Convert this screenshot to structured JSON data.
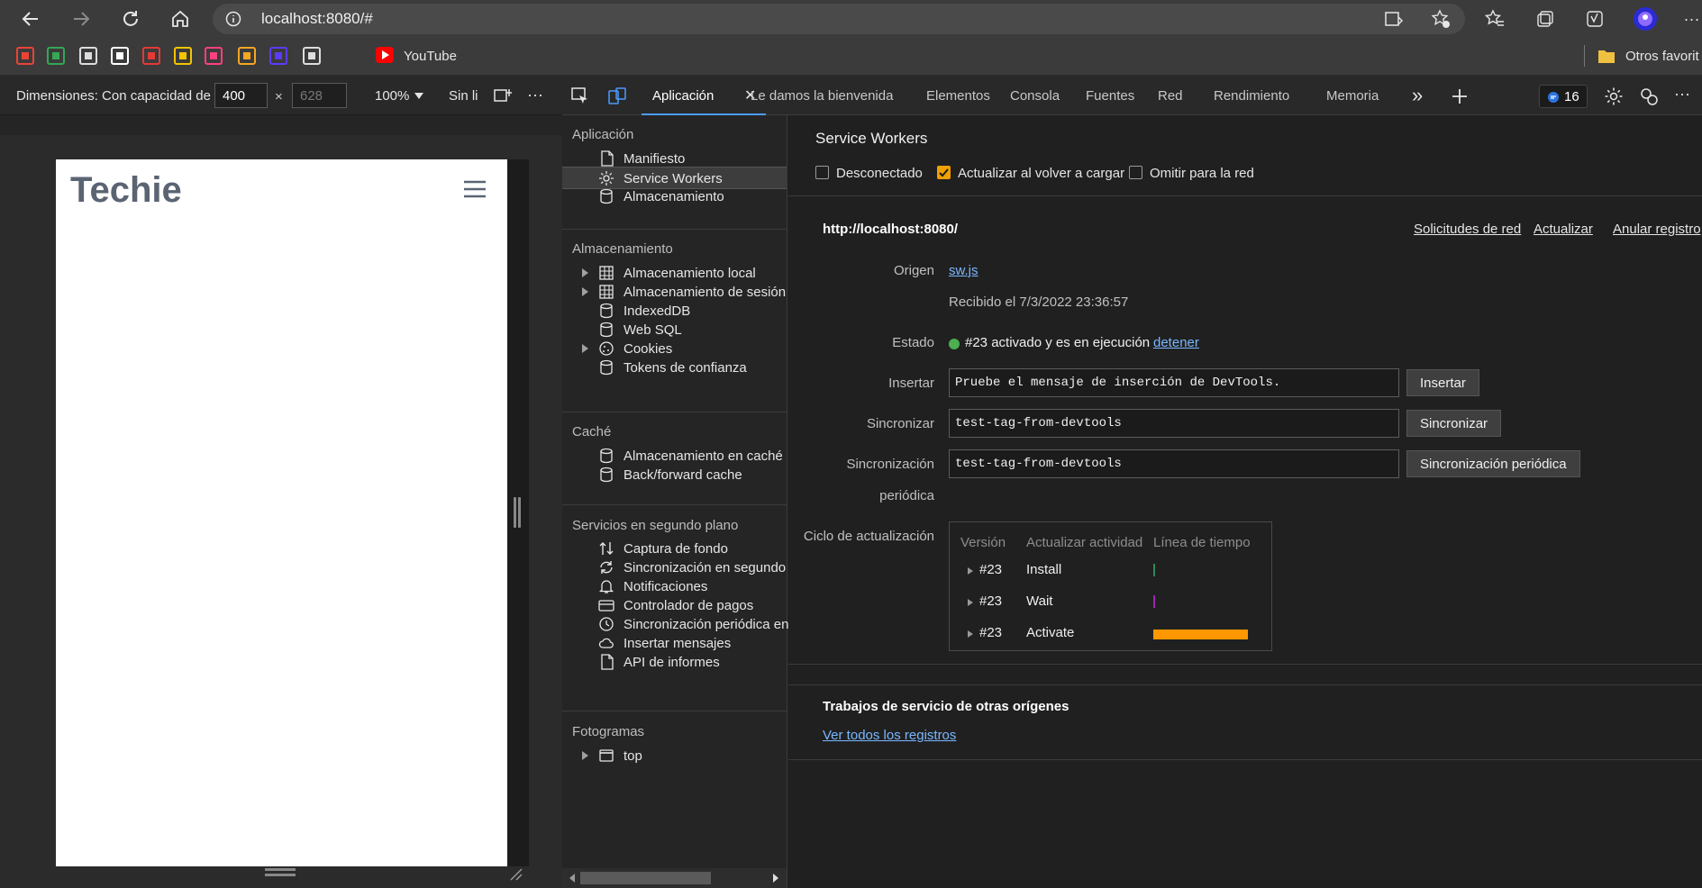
{
  "browser": {
    "url": "localhost:8080/#",
    "bookmarks": [
      {
        "icon": "gmail-icon",
        "color": "#ea4335"
      },
      {
        "icon": "drive-icon",
        "color": "#34a853"
      },
      {
        "icon": "bookmark-3-icon",
        "color": "#dddddd"
      },
      {
        "icon": "bookmark-4-icon",
        "color": "#ffffff"
      },
      {
        "icon": "bookmark-5-icon",
        "color": "#e53935"
      },
      {
        "icon": "bookmark-6-icon",
        "color": "#f2c500"
      },
      {
        "icon": "bookmark-7-icon",
        "color": "#ff4081"
      },
      {
        "icon": "bookmark-8-icon",
        "color": "#f5a623"
      },
      {
        "icon": "bookmark-9-icon",
        "color": "#5c3bff"
      },
      {
        "icon": "bookmark-10-icon",
        "color": "#dddddd"
      }
    ],
    "youtube_label": "YouTube",
    "other_favorites_label": "Otros favorit"
  },
  "device_toolbar": {
    "dimensions_label": "Dimensiones: Con capacidad de",
    "width": "400",
    "height_placeholder": "628",
    "times": "×",
    "zoom": "100%",
    "throttle": "Sin li",
    "more": "···"
  },
  "viewport": {
    "site_title": "Techie"
  },
  "devtools": {
    "tabs": {
      "application": "Aplicación",
      "welcome": "Le damos la bienvenida",
      "elements": "Elementos",
      "console": "Consola",
      "sources": "Fuentes",
      "network": "Red",
      "performance": "Rendimiento",
      "memory": "Memoria",
      "more": "»",
      "issues_count": "16"
    },
    "sidebar": {
      "application_header": "Aplicación",
      "application_items": [
        "Manifiesto",
        "Service Workers",
        "Almacenamiento"
      ],
      "storage_header": "Almacenamiento",
      "storage_items": [
        "Almacenamiento local",
        "Almacenamiento de sesión",
        "IndexedDB",
        "Web SQL",
        "Cookies",
        "Tokens de confianza"
      ],
      "cache_header": "Caché",
      "cache_items": [
        "Almacenamiento en caché",
        "Back/forward cache"
      ],
      "bg_header": "Servicios en segundo plano",
      "bg_items": [
        "Captura de fondo",
        "Sincronización en segundo",
        "Notificaciones",
        "Controlador de pagos",
        "Sincronización periódica en",
        "Insertar mensajes",
        "API de informes"
      ],
      "frames_header": "Fotogramas",
      "frames_items": [
        "top"
      ]
    },
    "panel": {
      "title": "Service Workers",
      "options": {
        "offline": "Desconectado",
        "update_on_reload": "Actualizar al volver a cargar",
        "bypass": "Omitir para la red"
      },
      "scope": "http://localhost:8080/",
      "actions": {
        "network_requests": "Solicitudes de red",
        "update": "Actualizar",
        "unregister": "Anular registro"
      },
      "source_label": "Origen",
      "source_file": "sw.js",
      "received": "Recibido el 7/3/2022 23:36:57",
      "status_label": "Estado",
      "status_text": "#23 activado y es en ejecución",
      "stop_link": "detener",
      "push_label": "Insertar",
      "push_value": "Pruebe el mensaje de inserción de DevTools.",
      "push_button": "Insertar",
      "sync_label": "Sincronizar",
      "sync_value": "test-tag-from-devtools",
      "sync_button": "Sincronizar",
      "psync_label_1": "Sincronización",
      "psync_label_2": "periódica",
      "psync_value": "test-tag-from-devtools",
      "psync_button": "Sincronización periódica",
      "cycle_label": "Ciclo de actualización",
      "cycle_headers": [
        "Versión",
        "Actualizar actividad",
        "Línea de tiempo"
      ],
      "cycle_rows": [
        {
          "version": "#23",
          "activity": "Install"
        },
        {
          "version": "#23",
          "activity": "Wait"
        },
        {
          "version": "#23",
          "activity": "Activate"
        }
      ],
      "other_origins_title": "Trabajos de servicio de otras orígenes",
      "see_all": "Ver todos los registros"
    }
  }
}
